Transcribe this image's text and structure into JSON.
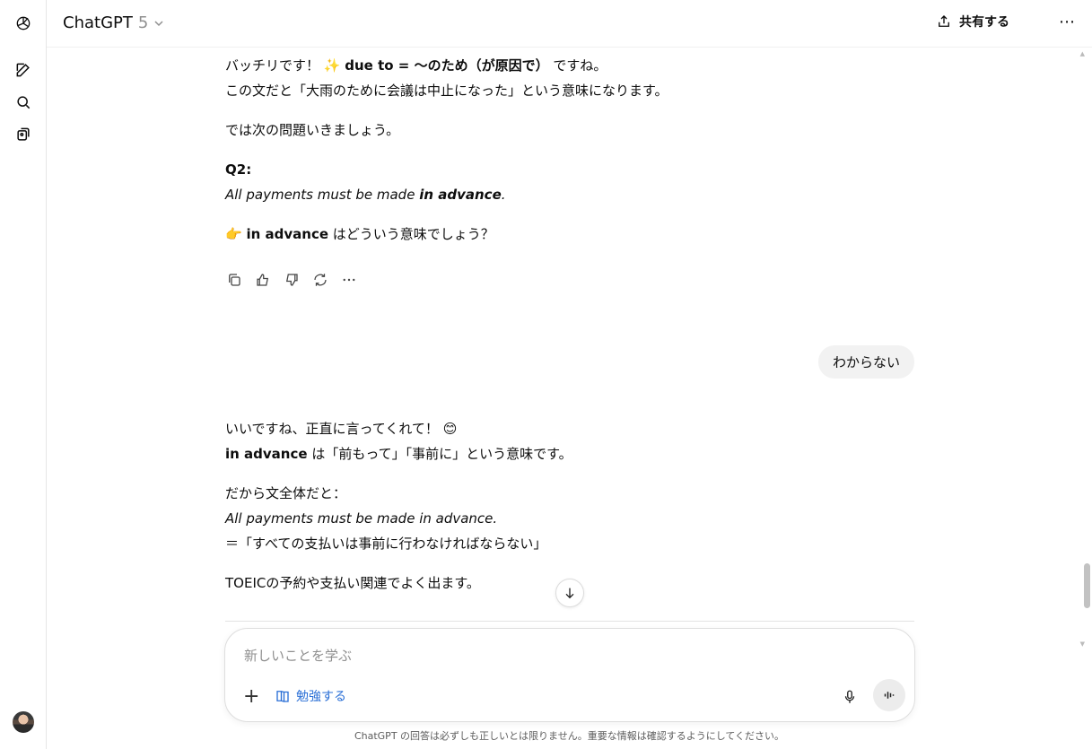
{
  "header": {
    "model_name": "ChatGPT",
    "model_version": "5",
    "share_label": "共有する",
    "more_label": "⋯"
  },
  "messages": {
    "m1_pre": "バッチリです！",
    "m1_emoji": "✨",
    "m1_bold": "due to = 〜のため（が原因で）",
    "m1_post": "ですね。",
    "m2": "この文だと「大雨のために会議は中止になった」という意味になります。",
    "m3": "では次の問題いきましょう。",
    "q_label": "Q2:",
    "q_text_pre": "All payments must be made ",
    "q_text_bold": "in advance",
    "q_text_post": ".",
    "point_emoji": "👉",
    "point_bold": "in advance",
    "point_post": "はどういう意味でしょう？",
    "user_reply": "わからない",
    "r1_pre": "いいですね、正直に言ってくれて！",
    "r1_emoji": "😊",
    "r2_bold": "in advance",
    "r2_post": "は「前もって」「事前に」という意味です。",
    "r3": "だから文全体だと：",
    "r4": "All payments must be made in advance.",
    "r5": "＝「すべての支払いは事前に行わなければならない」",
    "r6": "TOEICの予約や支払い関連でよく出ます。"
  },
  "composer": {
    "placeholder": "新しいことを学ぶ",
    "study_label": "勉強する"
  },
  "footer": {
    "disclaimer": "ChatGPT の回答は必ずしも正しいとは限りません。重要な情報は確認するようにしてください。"
  },
  "colors": {
    "accent": "#2a6fd6",
    "bubble": "#f2f2f2",
    "muted": "#8f8f8f"
  }
}
